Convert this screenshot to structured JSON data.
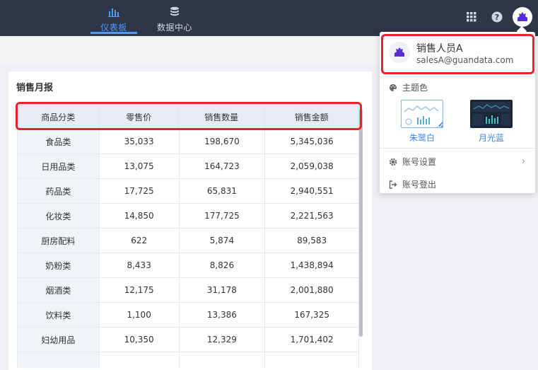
{
  "nav": {
    "items": [
      {
        "label": "仪表板",
        "icon": "bar-chart-icon",
        "active": true
      },
      {
        "label": "数据中心",
        "icon": "database-icon",
        "active": false
      }
    ]
  },
  "toolbar": {
    "apps_icon": "grid-icon",
    "help_icon": "help-icon",
    "avatar_icon": "user-avatar-icon"
  },
  "card": {
    "title": "销售月报",
    "columns": [
      "商品分类",
      "零售价",
      "销售数量",
      "销售金额"
    ],
    "rows": [
      [
        "食品类",
        "35,033",
        "198,670",
        "5,345,036"
      ],
      [
        "日用品类",
        "13,075",
        "164,723",
        "2,059,038"
      ],
      [
        "药品类",
        "17,725",
        "65,831",
        "2,940,551"
      ],
      [
        "化妆类",
        "14,850",
        "177,725",
        "2,221,563"
      ],
      [
        "厨房配料",
        "622",
        "5,874",
        "89,583"
      ],
      [
        "奶粉类",
        "8,433",
        "8,826",
        "1,438,894"
      ],
      [
        "烟酒类",
        "12,175",
        "31,178",
        "2,001,880"
      ],
      [
        "饮料类",
        "1,100",
        "13,386",
        "167,325"
      ],
      [
        "妇幼用品",
        "10,350",
        "12,329",
        "1,701,402"
      ]
    ]
  },
  "dropdown": {
    "user_name": "销售人员A",
    "user_email": "salesA@guandata.com",
    "theme_label": "主题色",
    "themes": [
      {
        "label": "朱鹭白",
        "selected": true
      },
      {
        "label": "月光蓝",
        "selected": false
      }
    ],
    "account_settings": "账号设置",
    "logout": "账号登出"
  },
  "colors": {
    "accent": "#4a9dff",
    "topbar": "#2e3648",
    "highlight": "#e8232a",
    "avatar": "#5b2bd6"
  }
}
